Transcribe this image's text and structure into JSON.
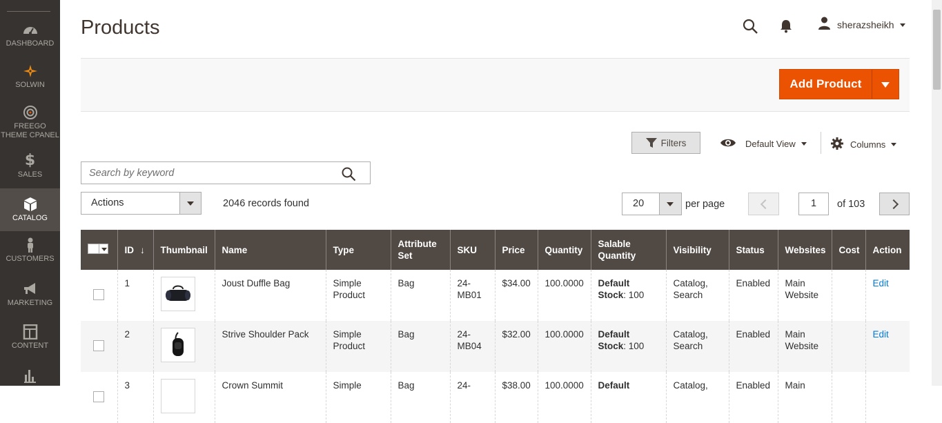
{
  "sidebar": {
    "items": [
      {
        "label": "DASHBOARD",
        "icon": "dashboard-icon"
      },
      {
        "label": "SOLWIN",
        "icon": "solwin-icon"
      },
      {
        "label": "FREEGO THEME CPANEL",
        "icon": "target-icon"
      },
      {
        "label": "SALES",
        "icon": "dollar-icon"
      },
      {
        "label": "CATALOG",
        "icon": "cube-icon"
      },
      {
        "label": "CUSTOMERS",
        "icon": "person-icon"
      },
      {
        "label": "MARKETING",
        "icon": "megaphone-icon"
      },
      {
        "label": "CONTENT",
        "icon": "layout-icon"
      },
      {
        "label": "",
        "icon": "bar-chart-icon"
      }
    ],
    "active": "CATALOG"
  },
  "header": {
    "title": "Products",
    "username": "sherazsheikh"
  },
  "actionbar": {
    "add_product_label": "Add Product"
  },
  "toolbar": {
    "filters_label": "Filters",
    "view_label": "Default View",
    "columns_label": "Columns",
    "search_placeholder": "Search by keyword",
    "actions_label": "Actions",
    "records_found": "2046 records found",
    "per_page_value": "20",
    "per_page_label": "per page",
    "current_page": "1",
    "total_pages_label": "of 103"
  },
  "grid": {
    "columns": [
      "ID",
      "Thumbnail",
      "Name",
      "Type",
      "Attribute Set",
      "SKU",
      "Price",
      "Quantity",
      "Salable Quantity",
      "Visibility",
      "Status",
      "Websites",
      "Cost",
      "Action"
    ],
    "rows": [
      {
        "id": "1",
        "name": "Joust Duffle Bag",
        "type": "Simple Product",
        "attribute_set": "Bag",
        "sku": "24-MB01",
        "price": "$34.00",
        "quantity": "100.0000",
        "salable_label": "Default Stock",
        "salable_value": ": 100",
        "visibility": "Catalog, Search",
        "status": "Enabled",
        "websites": "Main Website",
        "cost": "",
        "action": "Edit"
      },
      {
        "id": "2",
        "name": "Strive Shoulder Pack",
        "type": "Simple Product",
        "attribute_set": "Bag",
        "sku": "24-MB04",
        "price": "$32.00",
        "quantity": "100.0000",
        "salable_label": "Default Stock",
        "salable_value": ": 100",
        "visibility": "Catalog, Search",
        "status": "Enabled",
        "websites": "Main Website",
        "cost": "",
        "action": "Edit"
      },
      {
        "id": "3",
        "name": "Crown Summit",
        "type": "Simple",
        "attribute_set": "Bag",
        "sku": "24-",
        "price": "$38.00",
        "quantity": "100.0000",
        "salable_label": "Default",
        "salable_value": "",
        "visibility": "Catalog,",
        "status": "Enabled",
        "websites": "Main",
        "cost": "",
        "action": ""
      }
    ]
  },
  "colors": {
    "sidebar_bg": "#373330",
    "sidebar_active": "#524d49",
    "accent_orange": "#eb5202",
    "grid_header": "#514943",
    "link_blue": "#007bdb"
  }
}
